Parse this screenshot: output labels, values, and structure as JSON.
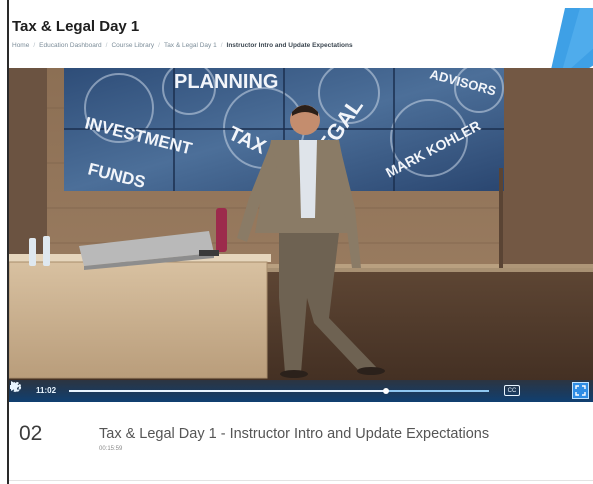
{
  "page": {
    "title": "Tax & Legal Day 1"
  },
  "breadcrumb": [
    {
      "label": "Home"
    },
    {
      "label": "Education Dashboard"
    },
    {
      "label": "Course Library"
    },
    {
      "label": "Tax & Legal Day 1"
    },
    {
      "label": "Instructor Intro and Update Expectations"
    }
  ],
  "video": {
    "screen_words": [
      "PLANNING",
      "INVESTMENT",
      "FUNDS",
      "TAX",
      "LEGAL",
      "MARK KOHLER",
      "ADVISORS"
    ],
    "player": {
      "time": "11:02",
      "progress": 0.755,
      "cc_label": "CC",
      "icons": {
        "play": "play-icon",
        "volume": "volume-icon",
        "settings": "gear-icon",
        "fullscreen": "fullscreen-icon"
      },
      "accent_color": "#2f8de4"
    }
  },
  "lesson": {
    "number": "02",
    "title": "Tax & Legal Day 1 - Instructor Intro and Update Expectations",
    "duration": "00:15:59"
  }
}
